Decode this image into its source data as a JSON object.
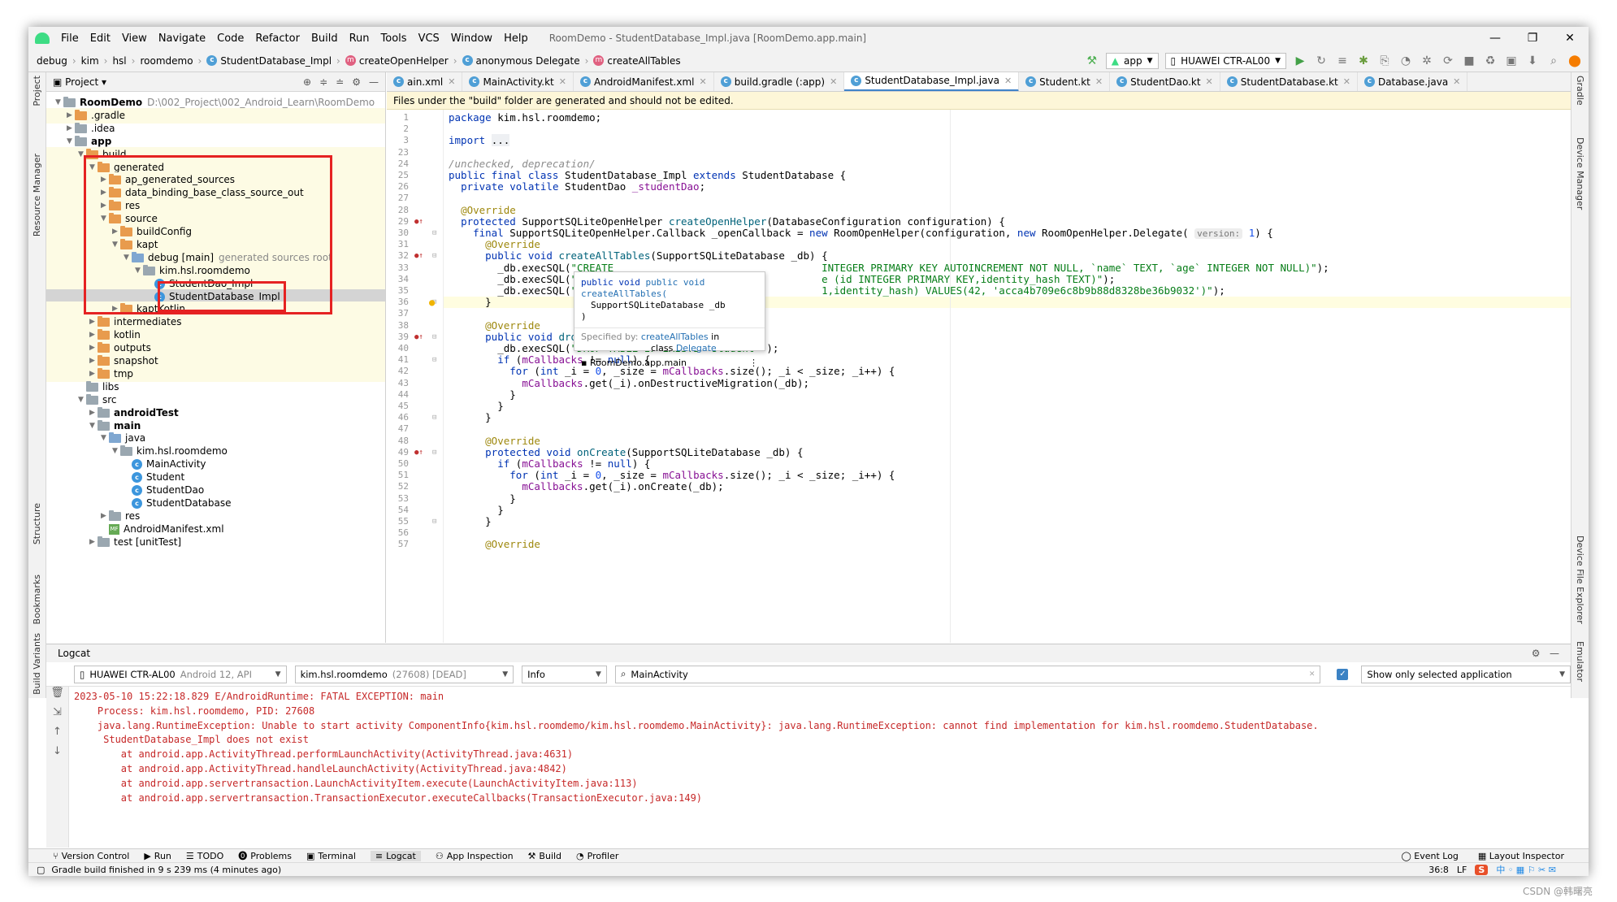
{
  "window": {
    "title": "RoomDemo - StudentDatabase_Impl.java [RoomDemo.app.main]",
    "menu": [
      "File",
      "Edit",
      "View",
      "Navigate",
      "Code",
      "Refactor",
      "Build",
      "Run",
      "Tools",
      "VCS",
      "Window",
      "Help"
    ]
  },
  "breadcrumb": [
    "debug",
    "kim",
    "hsl",
    "roomdemo",
    "StudentDatabase_Impl",
    "createOpenHelper",
    "anonymous Delegate",
    "createAllTables"
  ],
  "toolbar": {
    "run_config": "app",
    "device": "HUAWEI CTR-AL00"
  },
  "left_strip": [
    "Project",
    "Resource Manager",
    "Structure",
    "Bookmarks",
    "Build Variants"
  ],
  "right_strip": [
    "Gradle",
    "Device Manager",
    "Device File Explorer",
    "Emulator"
  ],
  "project": {
    "header": "Project",
    "tree": [
      {
        "label": "RoomDemo",
        "extra": "D:\\002_Project\\002_Android_Learn\\RoomDemo",
        "depth": 0,
        "arrow": "open",
        "icon": "g",
        "bold": true
      },
      {
        "label": ".gradle",
        "depth": 1,
        "arrow": "closed",
        "icon": "o",
        "yel": true
      },
      {
        "label": ".idea",
        "depth": 1,
        "arrow": "closed",
        "icon": "g"
      },
      {
        "label": "app",
        "depth": 1,
        "arrow": "open",
        "icon": "g",
        "bold": true
      },
      {
        "label": "build",
        "depth": 2,
        "arrow": "open",
        "icon": "o",
        "yel": true
      },
      {
        "label": "generated",
        "depth": 3,
        "arrow": "open",
        "icon": "o",
        "yel": true
      },
      {
        "label": "ap_generated_sources",
        "depth": 4,
        "arrow": "closed",
        "icon": "o",
        "yel": true
      },
      {
        "label": "data_binding_base_class_source_out",
        "depth": 4,
        "arrow": "closed",
        "icon": "o",
        "yel": true
      },
      {
        "label": "res",
        "depth": 4,
        "arrow": "closed",
        "icon": "o",
        "yel": true
      },
      {
        "label": "source",
        "depth": 4,
        "arrow": "open",
        "icon": "o",
        "yel": true
      },
      {
        "label": "buildConfig",
        "depth": 5,
        "arrow": "closed",
        "icon": "o",
        "yel": true
      },
      {
        "label": "kapt",
        "depth": 5,
        "arrow": "open",
        "icon": "o",
        "yel": true
      },
      {
        "label": "debug [main]",
        "extra": "generated sources root",
        "depth": 6,
        "arrow": "open",
        "icon": "b",
        "yel": true
      },
      {
        "label": "kim.hsl.roomdemo",
        "depth": 7,
        "arrow": "open",
        "icon": "g",
        "yel": true
      },
      {
        "label": "StudentDao_Impl",
        "depth": 8,
        "arrow": "none",
        "icon": "c",
        "yel": true
      },
      {
        "label": "StudentDatabase_Impl",
        "depth": 8,
        "arrow": "none",
        "icon": "c",
        "sel": true
      },
      {
        "label": "kaptKotlin",
        "depth": 5,
        "arrow": "closed",
        "icon": "o",
        "yel": true
      },
      {
        "label": "intermediates",
        "depth": 3,
        "arrow": "closed",
        "icon": "o",
        "yel": true
      },
      {
        "label": "kotlin",
        "depth": 3,
        "arrow": "closed",
        "icon": "o",
        "yel": true
      },
      {
        "label": "outputs",
        "depth": 3,
        "arrow": "closed",
        "icon": "o",
        "yel": true
      },
      {
        "label": "snapshot",
        "depth": 3,
        "arrow": "closed",
        "icon": "o",
        "yel": true
      },
      {
        "label": "tmp",
        "depth": 3,
        "arrow": "closed",
        "icon": "o",
        "yel": true
      },
      {
        "label": "libs",
        "depth": 2,
        "arrow": "none",
        "icon": "g"
      },
      {
        "label": "src",
        "depth": 2,
        "arrow": "open",
        "icon": "g"
      },
      {
        "label": "androidTest",
        "depth": 3,
        "arrow": "closed",
        "icon": "g",
        "bold": true
      },
      {
        "label": "main",
        "depth": 3,
        "arrow": "open",
        "icon": "g",
        "bold": true
      },
      {
        "label": "java",
        "depth": 4,
        "arrow": "open",
        "icon": "b"
      },
      {
        "label": "kim.hsl.roomdemo",
        "depth": 5,
        "arrow": "open",
        "icon": "g"
      },
      {
        "label": "MainActivity",
        "depth": 6,
        "arrow": "none",
        "icon": "c"
      },
      {
        "label": "Student",
        "depth": 6,
        "arrow": "none",
        "icon": "c"
      },
      {
        "label": "StudentDao",
        "depth": 6,
        "arrow": "none",
        "icon": "c"
      },
      {
        "label": "StudentDatabase",
        "depth": 6,
        "arrow": "none",
        "icon": "c"
      },
      {
        "label": "res",
        "depth": 4,
        "arrow": "closed",
        "icon": "g"
      },
      {
        "label": "AndroidManifest.xml",
        "depth": 4,
        "arrow": "none",
        "icon": "x"
      },
      {
        "label": "test [unitTest]",
        "depth": 3,
        "arrow": "closed",
        "icon": "g"
      }
    ]
  },
  "editor": {
    "tabs": [
      {
        "label": "ain.xml",
        "active": false
      },
      {
        "label": "MainActivity.kt",
        "active": false
      },
      {
        "label": "AndroidManifest.xml",
        "active": false
      },
      {
        "label": "build.gradle (:app)",
        "active": false
      },
      {
        "label": "StudentDatabase_Impl.java",
        "active": true
      },
      {
        "label": "Student.kt",
        "active": false
      },
      {
        "label": "StudentDao.kt",
        "active": false
      },
      {
        "label": "StudentDatabase.kt",
        "active": false
      },
      {
        "label": "Database.java",
        "active": false
      }
    ],
    "banner": "Files under the \"build\" folder are generated and should not be edited.",
    "popup": {
      "sig1": "public void createAllTables(",
      "sig2": "SupportSQLiteDatabase _db",
      "sig3": ")",
      "spec": "Specified by:",
      "spec_link": "createAllTables",
      "spec_in": "in",
      "spec_class": "class",
      "spec_class_link": "Delegate",
      "module": "RoomDemo.app.main"
    }
  },
  "logcat": {
    "title": "Logcat",
    "device": "HUAWEI CTR-AL00",
    "device_os": "Android 12, API",
    "process": "kim.hsl.roomdemo",
    "process_pid": "(27608) [DEAD]",
    "level": "Info",
    "search": "MainActivity",
    "show_only": "Show only selected application",
    "lines": [
      "2023-05-10 15:22:18.829 E/AndroidRuntime: FATAL EXCEPTION: main",
      "    Process: kim.hsl.roomdemo, PID: 27608",
      "    java.lang.RuntimeException: Unable to start activity ComponentInfo{kim.hsl.roomdemo/kim.hsl.roomdemo.MainActivity}: java.lang.RuntimeException: cannot find implementation for kim.hsl.roomdemo.StudentDatabase.",
      "     StudentDatabase_Impl does not exist",
      "        at android.app.ActivityThread.performLaunchActivity(ActivityThread.java:4631)",
      "        at android.app.ActivityThread.handleLaunchActivity(ActivityThread.java:4842)",
      "        at android.app.servertransaction.LaunchActivityItem.execute(LaunchActivityItem.java:113)",
      "        at android.app.servertransaction.TransactionExecutor.executeCallbacks(TransactionExecutor.java:149)"
    ]
  },
  "bottom_tabs": [
    "Version Control",
    "Run",
    "TODO",
    "Problems",
    "Terminal",
    "Logcat",
    "App Inspection",
    "Build",
    "Profiler"
  ],
  "bottom_right": [
    "Event Log",
    "Layout Inspector"
  ],
  "status": {
    "message": "Gradle build finished in 9 s 239 ms (4 minutes ago)",
    "position": "36:8",
    "line_sep": "LF"
  },
  "watermark": "CSDN @韩曙亮"
}
